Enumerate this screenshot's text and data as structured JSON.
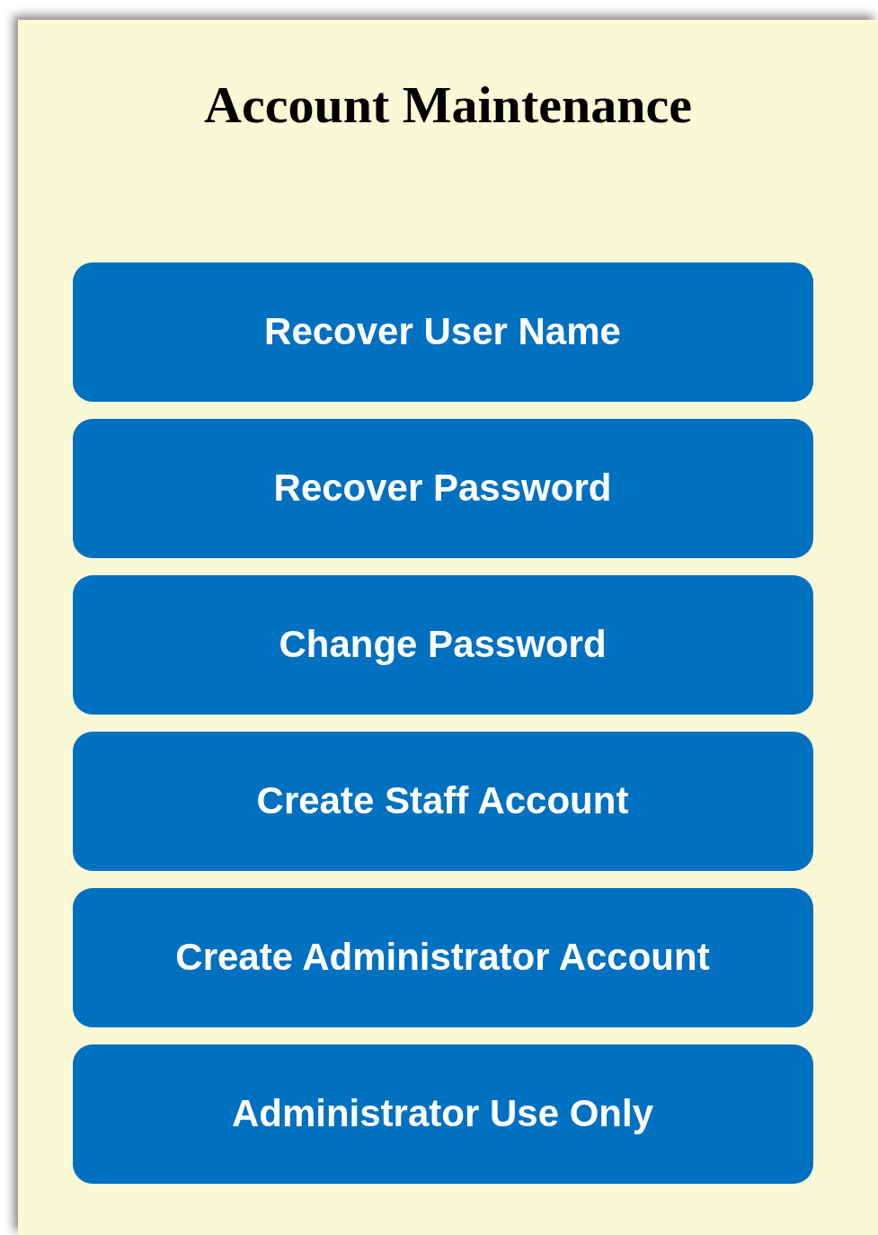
{
  "title": "Account Maintenance",
  "buttons": [
    "Recover User Name",
    "Recover Password",
    "Change Password",
    "Create Staff Account",
    "Create Administrator Account",
    "Administrator Use Only"
  ]
}
